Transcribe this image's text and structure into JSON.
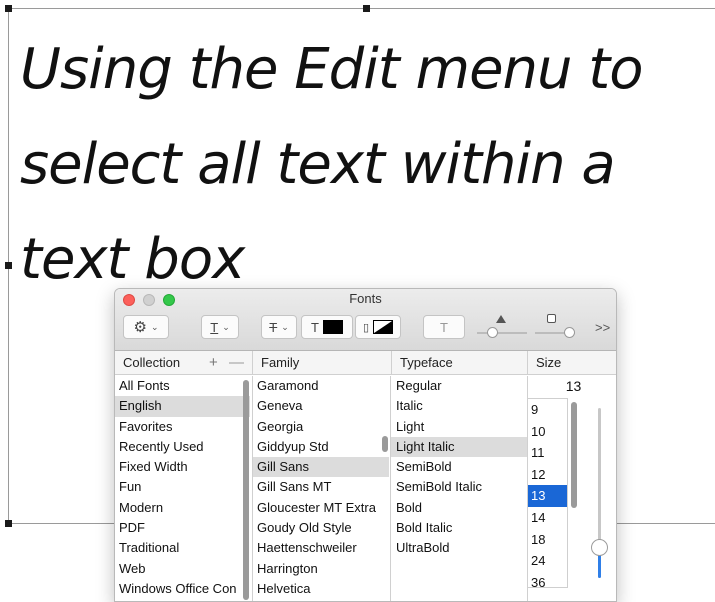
{
  "slide": {
    "text_lines": [
      "Using the Edit menu to",
      "select all text within a",
      "text box"
    ]
  },
  "fonts_panel": {
    "title": "Fonts",
    "toolbar": {
      "gear_icon": "gear-icon",
      "underline_label": "T",
      "strikethrough_label": "T",
      "text_color_label": "T",
      "doc_color_label": "▯",
      "shadow_label": "T",
      "more_label": ">>"
    },
    "headers": {
      "collection": "Collection",
      "family": "Family",
      "typeface": "Typeface",
      "size": "Size",
      "add": "+",
      "remove": "—"
    },
    "collections": [
      "All Fonts",
      "English",
      "Favorites",
      "Recently Used",
      "Fixed Width",
      "Fun",
      "Modern",
      "PDF",
      "Traditional",
      "Web",
      "Windows Office Con"
    ],
    "selected_collection": "English",
    "families": [
      "Garamond",
      "Geneva",
      "Georgia",
      "Giddyup Std",
      "Gill Sans",
      "Gill Sans MT",
      "Gloucester MT Extra",
      "Goudy Old Style",
      "Haettenschweiler",
      "Harrington",
      "Helvetica"
    ],
    "selected_family": "Gill Sans",
    "typefaces": [
      "Regular",
      "Italic",
      "Light",
      "Light Italic",
      "SemiBold",
      "SemiBold Italic",
      "Bold",
      "Bold Italic",
      "UltraBold"
    ],
    "selected_typeface": "Light Italic",
    "size_value": "13",
    "sizes": [
      "9",
      "10",
      "11",
      "12",
      "13",
      "14",
      "18",
      "24",
      "36"
    ],
    "selected_size": "13",
    "colors": {
      "selection_blue": "#1a67d6",
      "selection_gray": "#dcdcdc",
      "close": "#fc605b",
      "zoom": "#34c84a"
    }
  }
}
